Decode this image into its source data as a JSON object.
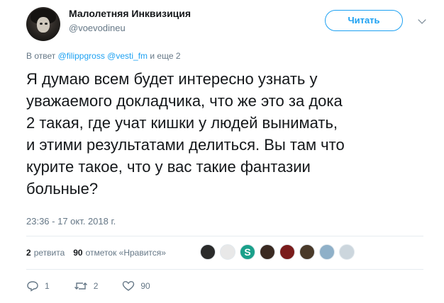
{
  "author": {
    "display_name": "Малолетняя Инквизиция",
    "handle": "@voevodineu",
    "follow_label": "Читать"
  },
  "reply_to": {
    "prefix": "В ответ",
    "mentions": [
      "@filippgross",
      "@vesti_fm"
    ],
    "suffix": "и еще 2"
  },
  "tweet": {
    "text": "Я думаю всем будет интересно узнать у\nуважаемого докладчика, что же это за дока\n2 такая, где учат кишки у людей вынимать,\nи этими результатами делиться. Вы там что\nкурите такое, что у вас такие фантазии\nбольные?",
    "timestamp": "23:36 - 17 окт. 2018 г."
  },
  "stats": {
    "retweets_count": "2",
    "retweets_label": "ретвита",
    "likes_count": "90",
    "likes_label": "отметок «Нравится»"
  },
  "likers": [
    {
      "name": "liker-1",
      "color": "#2b2b2b"
    },
    {
      "name": "liker-2",
      "color": "#e8e8e8"
    },
    {
      "name": "liker-3",
      "color": "#1aa08a",
      "letter": "S"
    },
    {
      "name": "liker-4",
      "color": "#3a2a22"
    },
    {
      "name": "liker-5",
      "color": "#7a1c1c"
    },
    {
      "name": "liker-6",
      "color": "#4a3a2a"
    },
    {
      "name": "liker-7",
      "color": "#8fb0c8"
    },
    {
      "name": "liker-8",
      "color": "#ccd6dd"
    }
  ],
  "actions": {
    "reply_count": "1",
    "retweet_count": "2",
    "like_count": "90"
  },
  "colors": {
    "accent": "#1da1f2",
    "muted": "#657786",
    "text": "#14171a"
  }
}
